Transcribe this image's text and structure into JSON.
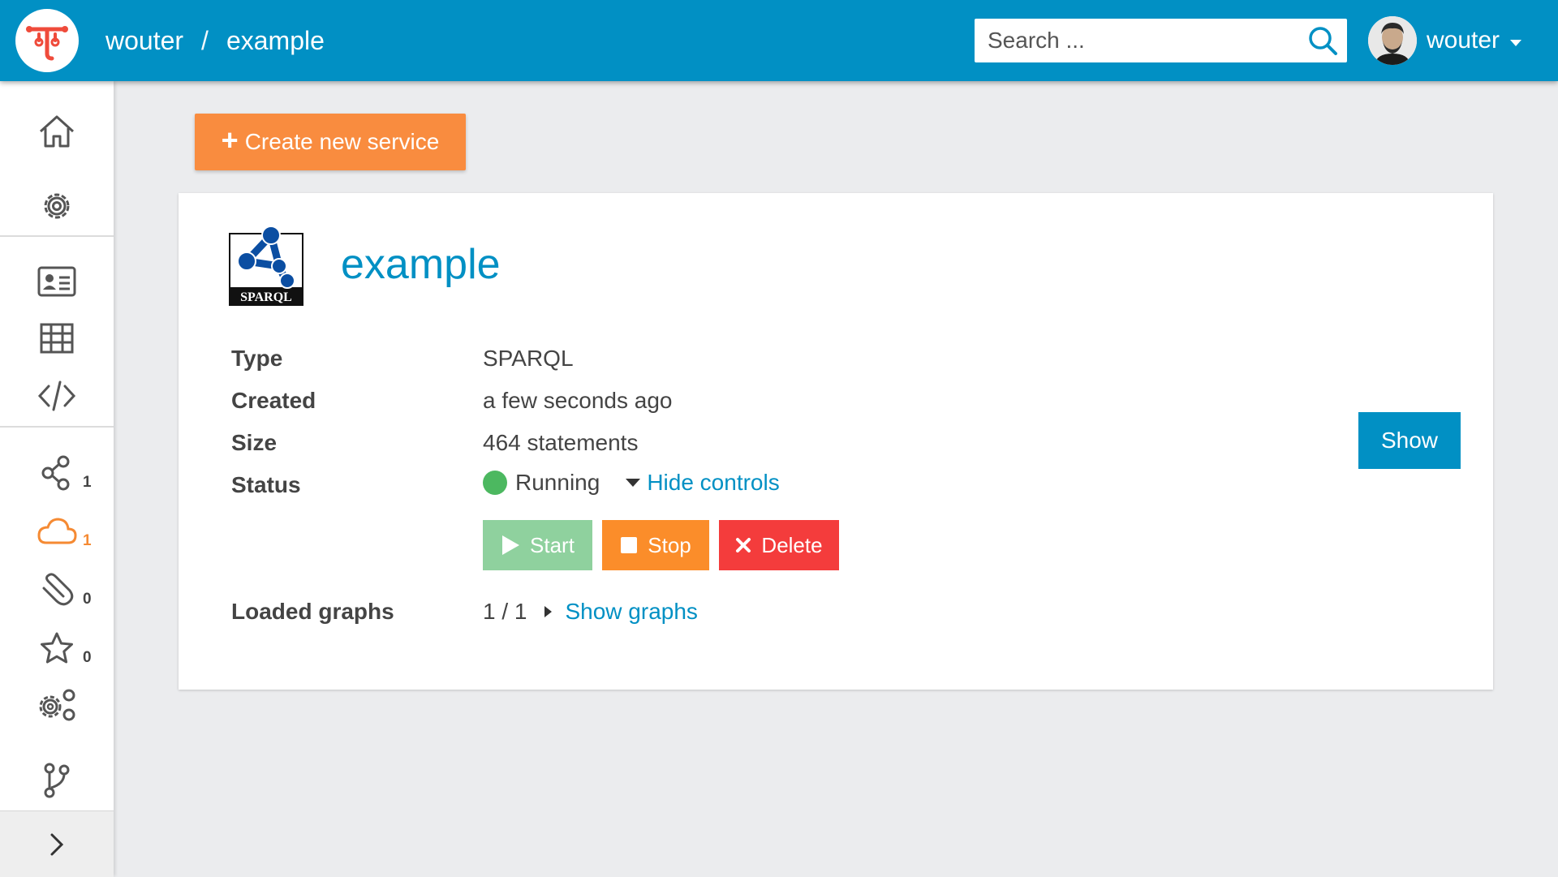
{
  "header": {
    "breadcrumb": {
      "owner": "wouter",
      "separator": "/",
      "dataset": "example"
    },
    "search": {
      "placeholder": "Search ..."
    },
    "user": {
      "name": "wouter"
    }
  },
  "sidebar": {
    "items": [
      {
        "icon": "home-icon"
      },
      {
        "icon": "settings-icon"
      },
      {
        "icon": "info-card-icon"
      },
      {
        "icon": "table-icon"
      },
      {
        "icon": "code-icon"
      },
      {
        "icon": "share-graph-icon",
        "count": "1"
      },
      {
        "icon": "cloud-icon",
        "count": "1"
      },
      {
        "icon": "paperclip-icon",
        "count": "0"
      },
      {
        "icon": "star-icon",
        "count": "0"
      },
      {
        "icon": "gears-icon"
      },
      {
        "icon": "git-branch-icon"
      }
    ],
    "expand_icon": "chevron-right-icon"
  },
  "main": {
    "create_button_label": "Create new service",
    "service": {
      "logo_text": "SPARQL",
      "title": "example",
      "fields": {
        "type_label": "Type",
        "type_value": "SPARQL",
        "created_label": "Created",
        "created_value": "a few seconds ago",
        "size_label": "Size",
        "size_value": "464 statements",
        "status_label": "Status",
        "status_value": "Running",
        "hide_controls": "Hide controls",
        "loaded_graphs_label": "Loaded graphs",
        "loaded_graphs_value": "1 / 1",
        "show_graphs": "Show graphs"
      },
      "controls": {
        "start": "Start",
        "stop": "Stop",
        "delete": "Delete"
      },
      "show_button": "Show"
    }
  },
  "colors": {
    "header_bg": "#0190c4",
    "create_btn": "#f98c3f",
    "start_btn": "#8fd19e",
    "stop_btn": "#fb8d2a",
    "delete_btn": "#f43c3c",
    "running_dot": "#4cb860",
    "link": "#0190c4"
  }
}
